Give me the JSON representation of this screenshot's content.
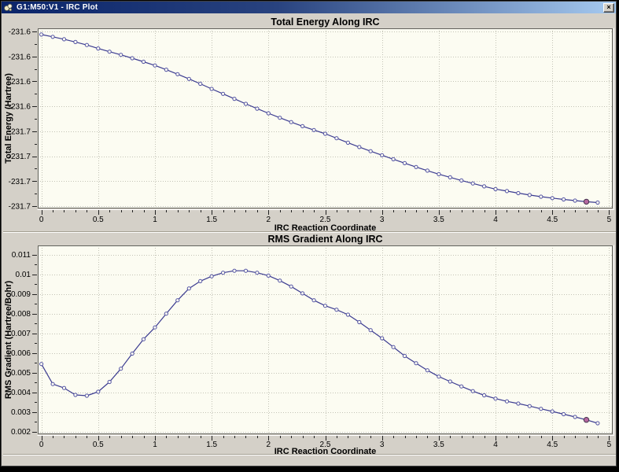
{
  "window": {
    "title": "G1:M50:V1 - IRC Plot",
    "close_glyph": "×"
  },
  "colors": {
    "titlebar_left": "#0a246a",
    "titlebar_right": "#a6caf0",
    "chrome": "#d4d0c8",
    "plot_bg": "#fcfcf2",
    "grid": "#c3c3b6",
    "axis": "#62625c",
    "curve": "#3b3b90",
    "marker_stroke": "#5151a3",
    "marker_fill": "#fcfcf2",
    "highlight_fill": "#b4679f",
    "highlight_stroke": "#46344e",
    "text": "#000000"
  },
  "chart_data": [
    {
      "type": "line",
      "name": "total-energy",
      "title": "Total Energy Along IRC",
      "xlabel": "IRC Reaction Coordinate",
      "ylabel": "Total Energy (Hartree)",
      "series_name": "Total Energy",
      "legend": "none",
      "grid": "dotted",
      "xlim": [
        -0.032,
        5.032
      ],
      "ylim": [
        -231.7274,
        -231.5468
      ],
      "x_ticks": {
        "values": [
          0,
          0.5,
          1,
          1.5,
          2,
          2.5,
          3,
          3.5,
          4,
          4.5,
          5
        ],
        "labels": [
          "0",
          "0.5",
          "1",
          "1.5",
          "2",
          "2.5",
          "3",
          "3.5",
          "4",
          "4.5",
          "5"
        ]
      },
      "x_minor_step": 0.1,
      "y_ticks": {
        "values": [
          -231.55,
          -231.575,
          -231.6,
          -231.625,
          -231.65,
          -231.675,
          -231.7,
          -231.725
        ],
        "labels": [
          "-231.6",
          "-231.6",
          "-231.6",
          "-231.6",
          "-231.7",
          "-231.7",
          "-231.7",
          "-231.7"
        ]
      },
      "x": [
        0,
        0.1,
        0.2,
        0.3,
        0.4,
        0.5,
        0.6,
        0.7,
        0.8,
        0.9,
        1,
        1.1,
        1.2,
        1.3,
        1.4,
        1.5,
        1.6,
        1.7,
        1.8,
        1.9,
        2,
        2.1,
        2.2,
        2.3,
        2.4,
        2.5,
        2.6,
        2.7,
        2.8,
        2.9,
        3,
        3.1,
        3.2,
        3.3,
        3.4,
        3.5,
        3.6,
        3.7,
        3.8,
        3.9,
        4,
        4.1,
        4.2,
        4.3,
        4.4,
        4.5,
        4.6,
        4.7,
        4.8,
        4.9
      ],
      "y": [
        -231.553,
        -231.5553,
        -231.5578,
        -231.5605,
        -231.5635,
        -231.567,
        -231.5702,
        -231.5734,
        -231.5768,
        -231.5803,
        -231.584,
        -231.5883,
        -231.5928,
        -231.5975,
        -231.6024,
        -231.6075,
        -231.6125,
        -231.6175,
        -231.6225,
        -231.6273,
        -231.632,
        -231.6365,
        -231.6408,
        -231.6449,
        -231.6488,
        -231.6525,
        -231.657,
        -231.6615,
        -231.6658,
        -231.67,
        -231.674,
        -231.678,
        -231.682,
        -231.6858,
        -231.6895,
        -231.693,
        -231.6962,
        -231.6993,
        -231.7023,
        -231.7052,
        -231.708,
        -231.71,
        -231.712,
        -231.7139,
        -231.7156,
        -231.717,
        -231.7183,
        -231.7195,
        -231.7206,
        -231.7215
      ],
      "highlight_index": 48
    },
    {
      "type": "line",
      "name": "rms-gradient",
      "title": "RMS Gradient Along IRC",
      "xlabel": "IRC Reaction Coordinate",
      "ylabel": "RMS Gradient (Hartree/Bohr)",
      "series_name": "RMS Gradient",
      "legend": "none",
      "grid": "dotted",
      "xlim": [
        -0.032,
        5.032
      ],
      "ylim": [
        0.00187,
        0.011467
      ],
      "x_ticks": {
        "values": [
          0,
          0.5,
          1,
          1.5,
          2,
          2.5,
          3,
          3.5,
          4,
          4.5,
          5
        ],
        "labels": [
          "0",
          "0.5",
          "1",
          "1.5",
          "2",
          "2.5",
          "3",
          "3.5",
          "4",
          "4.5",
          "5"
        ]
      },
      "x_minor_step": 0.1,
      "y_ticks": {
        "values": [
          0.011,
          0.01,
          0.009,
          0.008,
          0.007,
          0.006,
          0.005,
          0.004,
          0.003,
          0.002
        ],
        "labels": [
          "0.011",
          "0.01",
          "0.009",
          "0.008",
          "0.007",
          "0.006",
          "0.005",
          "0.004",
          "0.003",
          "0.002"
        ]
      },
      "x": [
        0,
        0.1,
        0.2,
        0.3,
        0.4,
        0.5,
        0.6,
        0.7,
        0.8,
        0.9,
        1,
        1.1,
        1.2,
        1.3,
        1.4,
        1.5,
        1.6,
        1.7,
        1.8,
        1.9,
        2,
        2.1,
        2.2,
        2.3,
        2.4,
        2.5,
        2.6,
        2.7,
        2.8,
        2.9,
        3,
        3.1,
        3.2,
        3.3,
        3.4,
        3.5,
        3.6,
        3.7,
        3.8,
        3.9,
        4,
        4.1,
        4.2,
        4.3,
        4.4,
        4.5,
        4.6,
        4.7,
        4.8,
        4.9
      ],
      "y": [
        0.00544,
        0.00442,
        0.00422,
        0.00387,
        0.00383,
        0.00403,
        0.00453,
        0.0052,
        0.00597,
        0.0067,
        0.0073,
        0.008,
        0.00868,
        0.00928,
        0.00965,
        0.0099,
        0.01008,
        0.01018,
        0.01018,
        0.01008,
        0.00993,
        0.00968,
        0.00938,
        0.00903,
        0.00868,
        0.0084,
        0.0082,
        0.00795,
        0.00757,
        0.00716,
        0.00675,
        0.0063,
        0.00585,
        0.00548,
        0.00512,
        0.0048,
        0.00455,
        0.0043,
        0.00406,
        0.00385,
        0.00368,
        0.00354,
        0.00343,
        0.0033,
        0.00316,
        0.00303,
        0.00289,
        0.00275,
        0.0026,
        0.00243
      ],
      "highlight_index": 48
    }
  ]
}
